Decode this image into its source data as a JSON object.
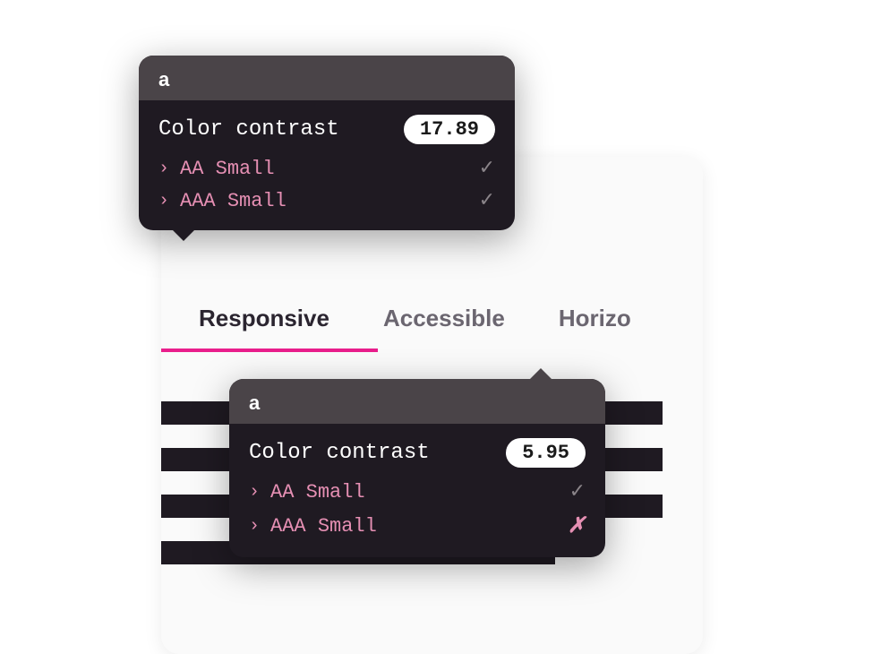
{
  "tabs": {
    "items": [
      {
        "label": "Responsive",
        "active": true
      },
      {
        "label": "Accessible",
        "active": false
      },
      {
        "label": "Horizo",
        "active": false
      }
    ]
  },
  "tooltip1": {
    "header": "a",
    "title": "Color contrast",
    "value": "17.89",
    "rows": [
      {
        "label": "AA Small",
        "pass": true
      },
      {
        "label": "AAA Small",
        "pass": true
      }
    ]
  },
  "tooltip2": {
    "header": "a",
    "title": "Color contrast",
    "value": "5.95",
    "rows": [
      {
        "label": "AA Small",
        "pass": true
      },
      {
        "label": "AAA Small",
        "pass": false
      }
    ]
  },
  "colors": {
    "accent": "#e91e8c",
    "pink_text": "#e58fb3",
    "tooltip_bg": "#1f1a22",
    "tooltip_header_bg": "#4a4448"
  }
}
